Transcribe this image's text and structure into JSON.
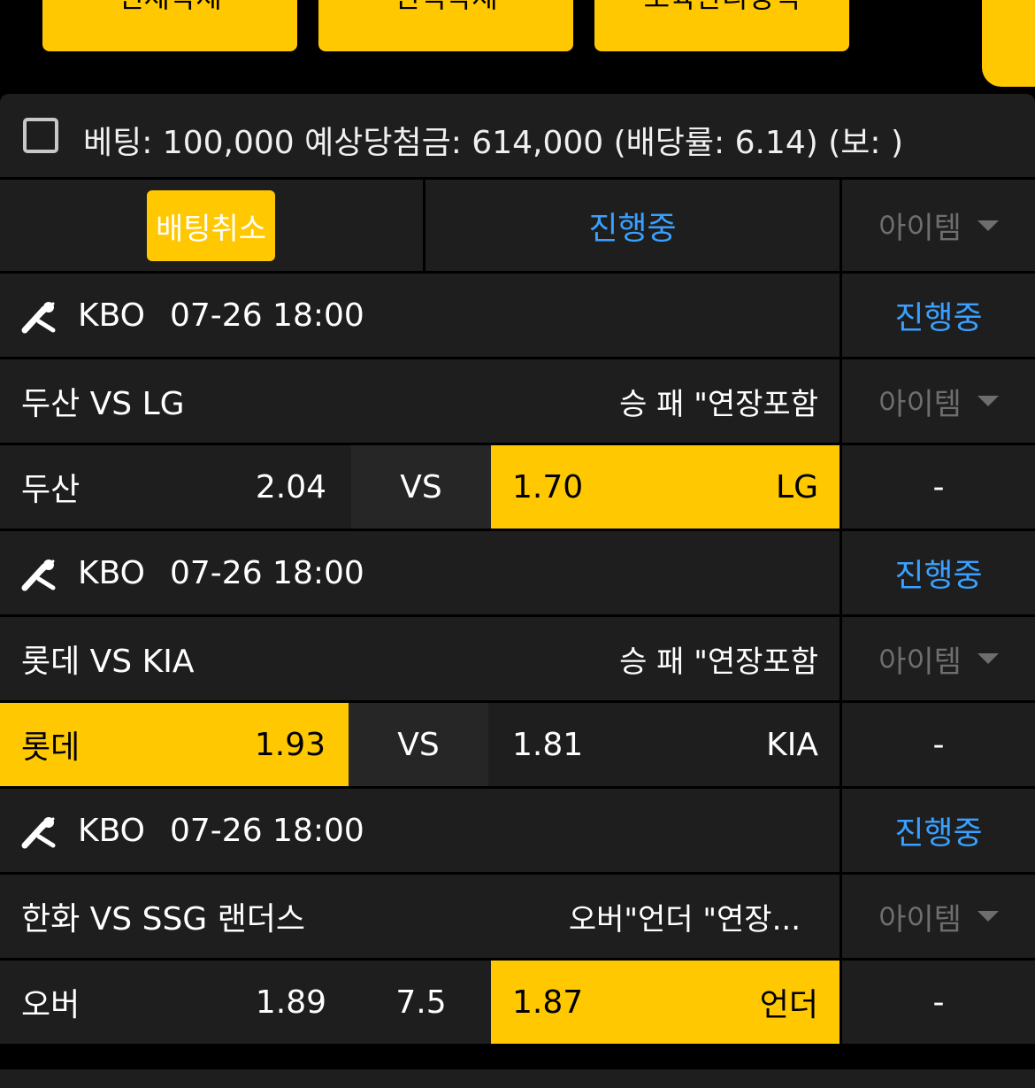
{
  "top_buttons": [
    "전체삭제",
    "선택삭제",
    "보육관리정책"
  ],
  "summary": {
    "text": "베팅: 100,000 예상당첨금: 614,000 (배당률: 6.14) (보: )"
  },
  "header_row": {
    "cancel_label": "배팅취소",
    "status": "진행중",
    "item_label": "아이템"
  },
  "games": [
    {
      "league": "KBO",
      "datetime": "07-26 18:00",
      "status": "진행중",
      "match": "두산 VS LG",
      "market": "승 패 \"연장포함",
      "item_label": "아이템",
      "home": "두산",
      "home_odds": "2.04",
      "mid": "VS",
      "away_odds": "1.70",
      "away": "LG",
      "extra": "-"
    },
    {
      "league": "KBO",
      "datetime": "07-26 18:00",
      "status": "진행중",
      "match": "롯데 VS KIA",
      "market": "승 패 \"연장포함",
      "item_label": "아이템",
      "home": "롯데",
      "home_odds": "1.93",
      "mid": "VS",
      "away_odds": "1.81",
      "away": "KIA",
      "extra": "-"
    },
    {
      "league": "KBO",
      "datetime": "07-26 18:00",
      "status": "진행중",
      "match": "한화 VS SSG 랜더스",
      "market": "오버\"언더 \"연장...",
      "item_label": "아이템",
      "home": "오버",
      "home_odds": "1.89",
      "mid": "7.5",
      "away_odds": "1.87",
      "away": "언더",
      "extra": "-"
    }
  ],
  "colors": {
    "accent": "#ffc800",
    "status": "#3aa0ff",
    "row_bg": "#1e1e1e",
    "muted": "#6e6e6e"
  }
}
